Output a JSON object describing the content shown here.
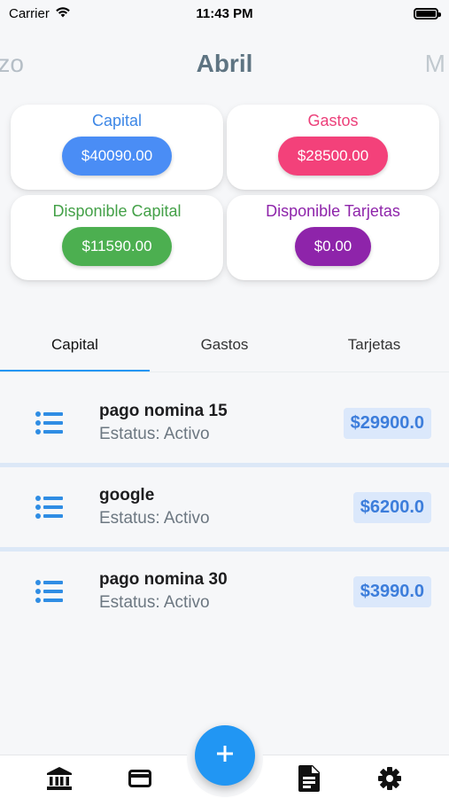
{
  "status_bar": {
    "carrier": "Carrier",
    "time": "11:43 PM"
  },
  "months": {
    "prev": "rzo",
    "current": "Abril",
    "next": "M"
  },
  "summary": [
    {
      "title": "Capital",
      "value": "$40090.00",
      "title_color": "#3d87e6",
      "pill_color": "#4a8df5"
    },
    {
      "title": "Gastos",
      "value": "$28500.00",
      "title_color": "#ec407a",
      "pill_color": "#f3417a"
    },
    {
      "title": "Disponible Capital",
      "value": "$11590.00",
      "title_color": "#43a047",
      "pill_color": "#4caf50"
    },
    {
      "title": "Disponible Tarjetas",
      "value": "$0.00",
      "title_color": "#8e24aa",
      "pill_color": "#8e24aa"
    }
  ],
  "tabs": [
    {
      "label": "Capital",
      "active": true
    },
    {
      "label": "Gastos",
      "active": false
    },
    {
      "label": "Tarjetas",
      "active": false
    }
  ],
  "items": [
    {
      "name": "pago nomina 15",
      "status": "Estatus: Activo",
      "amount": "$29900.0"
    },
    {
      "name": "google",
      "status": "Estatus: Activo",
      "amount": "$6200.0"
    },
    {
      "name": "pago nomina 30",
      "status": "Estatus: Activo",
      "amount": "$3990.0"
    }
  ],
  "bottom_nav": {
    "icons": [
      "bank-icon",
      "credit-card-icon",
      "document-icon",
      "settings-icon"
    ],
    "fab_icon": "plus-icon"
  },
  "colors": {
    "accent": "#2196f3",
    "muted": "#6c7781"
  }
}
